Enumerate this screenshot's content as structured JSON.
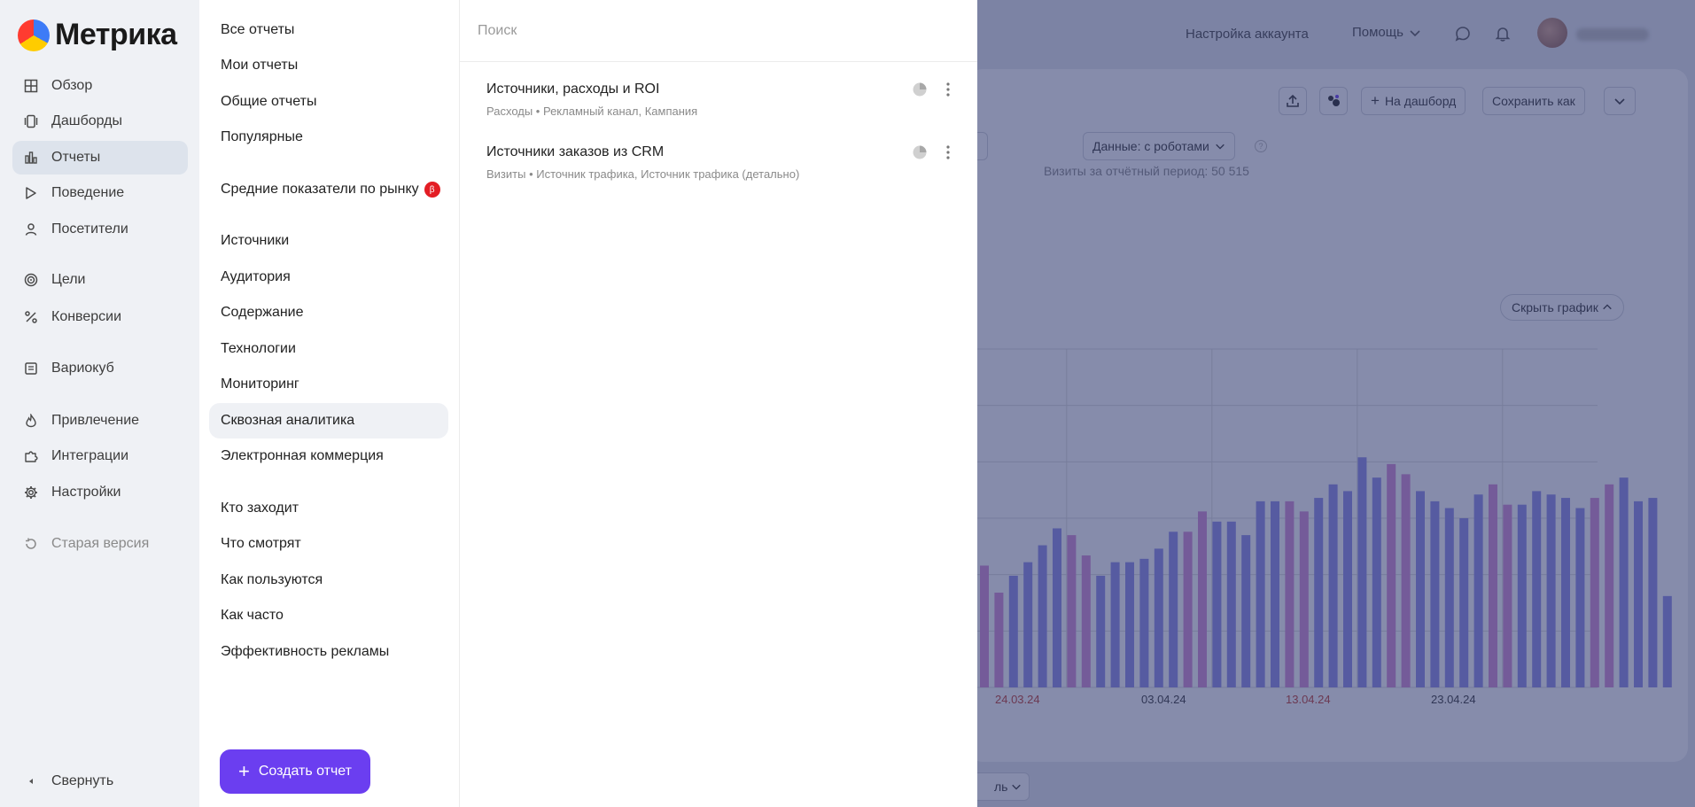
{
  "logo": {
    "text": "Метрика"
  },
  "nav": {
    "items": [
      {
        "label": "Обзор",
        "icon": "grid-icon"
      },
      {
        "label": "Дашборды",
        "icon": "dashboards-icon"
      },
      {
        "label": "Отчеты",
        "icon": "bar-chart-icon",
        "active": true
      },
      {
        "label": "Поведение",
        "icon": "play-icon"
      },
      {
        "label": "Посетители",
        "icon": "user-icon"
      },
      {
        "label": "Цели",
        "icon": "target-icon"
      },
      {
        "label": "Конверсии",
        "icon": "percent-icon"
      },
      {
        "label": "Вариокуб",
        "icon": "cube-icon"
      },
      {
        "label": "Привлечение",
        "icon": "flame-icon"
      },
      {
        "label": "Интеграции",
        "icon": "puzzle-icon"
      },
      {
        "label": "Настройки",
        "icon": "gear-icon"
      },
      {
        "label": "Старая версия",
        "icon": "history-icon"
      }
    ],
    "collapse_label": "Свернуть"
  },
  "reports_menu": {
    "items": [
      "Все отчеты",
      "Мои отчеты",
      "Общие отчеты",
      "Популярные",
      "Средние показатели по рынку",
      "Источники",
      "Аудитория",
      "Содержание",
      "Технологии",
      "Мониторинг",
      "Сквозная аналитика",
      "Электронная коммерция",
      "Кто заходит",
      "Что смотрят",
      "Как пользуются",
      "Как часто",
      "Эффективность рекламы"
    ],
    "active_item": "Сквозная аналитика",
    "badge": "β",
    "create_button": "Создать отчет"
  },
  "results": {
    "search_placeholder": "Поиск",
    "items": [
      {
        "title": "Источники, расходы и ROI",
        "subtitle": "Расходы • Рекламный канал, Кампания"
      },
      {
        "title": "Источники заказов из CRM",
        "subtitle": "Визиты • Источник трафика, Источник трафика (детально)"
      }
    ]
  },
  "background": {
    "account_settings": "Настройка аккаунта",
    "help": "Помощь",
    "visits_label": "Визиты за отчётный период: 50 515",
    "to_dashboard": "На дашборд",
    "save_as": "Сохранить как",
    "data_filter": "Данные: с роботами",
    "hide_graph": "Скрыть график",
    "bottom_partial": "ль",
    "chart_x_labels": [
      "24.03.24",
      "03.04.24",
      "13.04.24",
      "23.04.24"
    ],
    "chart_x_label_colors": [
      "#c0392b",
      "#333333",
      "#c0392b",
      "#333333"
    ]
  },
  "chart_data": {
    "type": "bar",
    "ylim": [
      0,
      100
    ],
    "tick_labels": [
      "24.03.24",
      "03.04.24",
      "13.04.24",
      "23.04.24"
    ],
    "values": [
      36,
      28,
      33,
      37,
      42,
      47,
      45,
      39,
      33,
      37,
      37,
      38,
      41,
      46,
      46,
      52,
      49,
      49,
      45,
      55,
      55,
      55,
      52,
      56,
      60,
      58,
      68,
      62,
      66,
      63,
      58,
      55,
      53,
      50,
      57,
      60,
      54,
      54,
      58,
      57,
      56,
      53,
      56,
      60,
      62,
      55,
      56,
      27
    ],
    "colors": {
      "weekday": "#8c8be8",
      "weekend": "#d58ad3"
    },
    "weekend_indices": [
      0,
      1,
      6,
      7,
      14,
      15,
      21,
      22,
      28,
      29,
      35,
      36,
      42,
      43
    ]
  }
}
